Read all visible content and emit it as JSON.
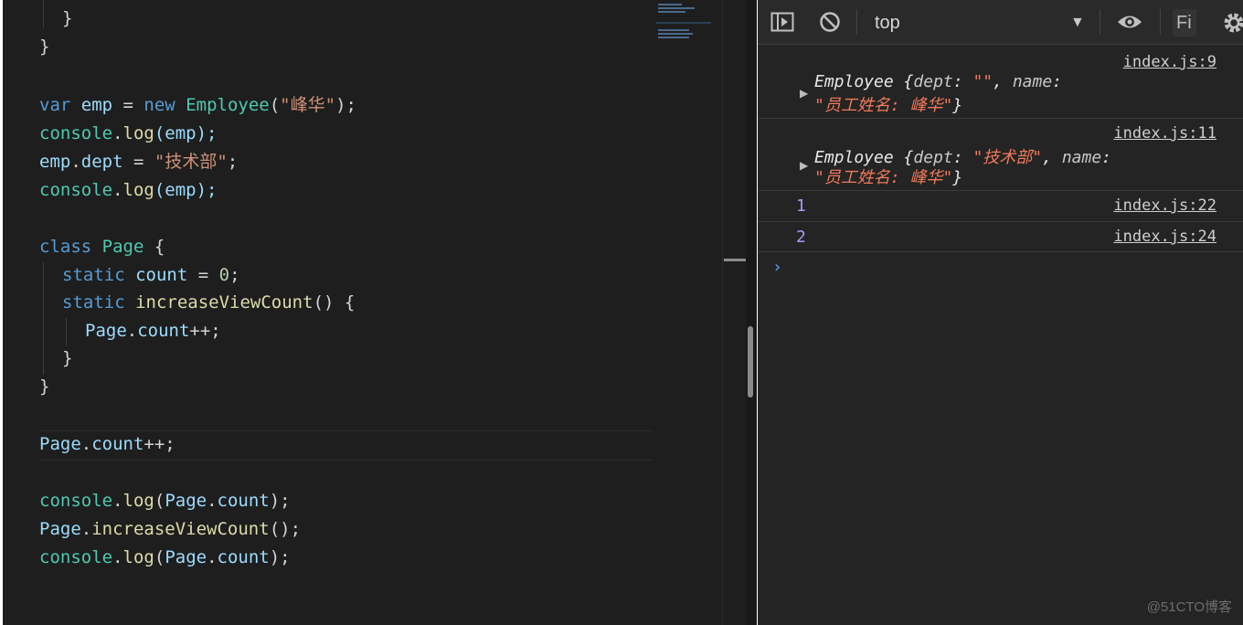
{
  "editor": {
    "lines": {
      "l1": "}",
      "l2": "}",
      "l3": {
        "kw": "var",
        "v": " emp ",
        "eq": "= ",
        "kw2": "new",
        "sp": " ",
        "cls": "Employee",
        "p1": "(",
        "str": "\"峰华\"",
        "p2": ");"
      },
      "l4": {
        "obj": "console",
        "dot": ".",
        "fn": "log",
        "args": "(emp);"
      },
      "l5": {
        "obj": "emp",
        "dot": ".",
        "prop": "dept",
        "eq": " = ",
        "str": "\"技术部\"",
        "end": ";"
      },
      "l6": {
        "obj": "console",
        "dot": ".",
        "fn": "log",
        "args": "(emp);"
      },
      "l7": {
        "kw": "class",
        "sp": " ",
        "cls": "Page",
        "end": " {"
      },
      "l8": {
        "kw": "static",
        "sp": " ",
        "prop": "count",
        "eq": " = ",
        "num": "0",
        "end": ";"
      },
      "l9": {
        "kw": "static",
        "sp": " ",
        "fn": "increaseViewCount",
        "end": "() {"
      },
      "l10": {
        "obj": "Page",
        "dot": ".",
        "prop": "count",
        "end": "++;"
      },
      "l11": "}",
      "l12": "}",
      "l13": {
        "obj": "Page",
        "dot": ".",
        "prop": "count",
        "end": "++;"
      },
      "l14": {
        "obj": "console",
        "dot": ".",
        "fn": "log",
        "p1": "(",
        "obj2": "Page",
        "dot2": ".",
        "prop": "count",
        "end": ");"
      },
      "l15": {
        "obj": "Page",
        "dot": ".",
        "fn": "increaseViewCount",
        "end": "();"
      },
      "l16": {
        "obj": "console",
        "dot": ".",
        "fn": "log",
        "p1": "(",
        "obj2": "Page",
        "dot2": ".",
        "prop": "count",
        "end": ");"
      }
    }
  },
  "devtools": {
    "toolbar": {
      "context": "top",
      "filter_partial": "Fi",
      "icons": [
        "sidebar-toggle-icon",
        "clear-console-icon",
        "eye-icon",
        "gear-icon"
      ]
    },
    "messages": [
      {
        "source": "index.js:9",
        "class_name": "Employee",
        "open": " {",
        "k1": "dept",
        "sep1": ": ",
        "v1": "\"\"",
        "comma": ", ",
        "k2": "name",
        "sep2": ":",
        "v2": "\"员工姓名: 峰华\"",
        "close": "}"
      },
      {
        "source": "index.js:11",
        "class_name": "Employee",
        "open": " {",
        "k1": "dept",
        "sep1": ": ",
        "v1": "\"技术部\"",
        "comma": ", ",
        "k2": "name",
        "sep2": ":",
        "v2": "\"员工姓名: 峰华\"",
        "close": "}"
      },
      {
        "source": "index.js:22",
        "value": "1"
      },
      {
        "source": "index.js:24",
        "value": "2"
      }
    ],
    "prompt": "›"
  },
  "watermark": "@51CTO博客",
  "colors": {
    "editor_bg": "#1e1e1e",
    "console_bg": "#242424",
    "keyword": "#569cd6",
    "class": "#4ec9b0",
    "function": "#dcdcaa",
    "string": "#ce9178",
    "console_string": "#f07a5a",
    "console_number": "#a89cf7",
    "prompt": "#5aa9ff"
  }
}
